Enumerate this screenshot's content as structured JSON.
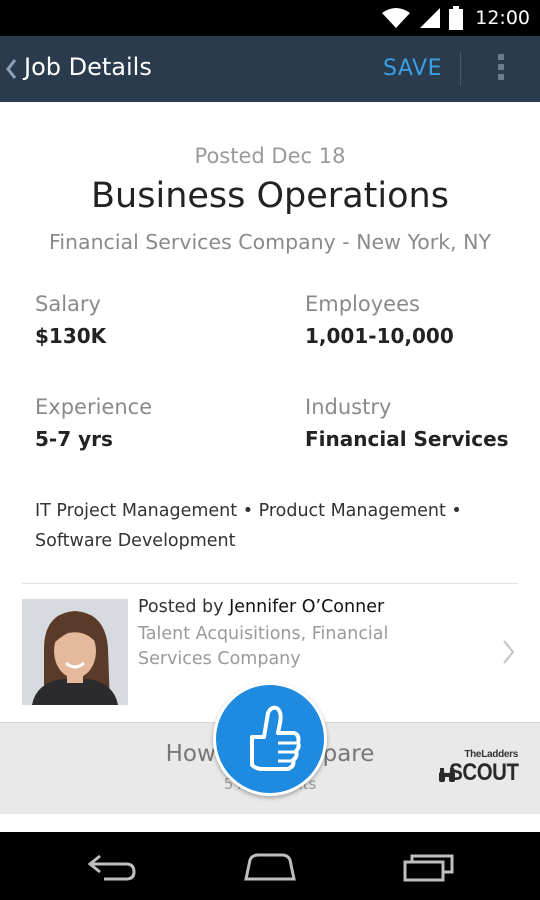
{
  "status_bar": {
    "time": "12:00",
    "icons": [
      "wifi-icon",
      "signal-icon",
      "battery-icon"
    ]
  },
  "action_bar": {
    "back_icon": "chevron-left-icon",
    "title": "Job Details",
    "save_label": "SAVE",
    "overflow_icon": "overflow-menu-icon"
  },
  "job": {
    "posted": "Posted Dec 18",
    "title": "Business Operations",
    "company_location": "Financial Services Company - New York, NY",
    "stats": {
      "salary_label": "Salary",
      "salary_value": "$130K",
      "employees_label": "Employees",
      "employees_value": "1,001-10,000",
      "experience_label": "Experience",
      "experience_value": "5-7 yrs",
      "industry_label": "Industry",
      "industry_value": "Financial Services"
    },
    "skills_line1": "IT Project Management • Product Management •",
    "skills_line2": "Software Development"
  },
  "poster": {
    "prefix": "Posted by ",
    "name": "Jennifer O’Conner",
    "role_line1": "Talent Acquisitions, Financial",
    "role_line2": "Services Company"
  },
  "compare": {
    "title": "How You Compare",
    "subtitle": "5 Applicants",
    "logo_small": "TheLadders",
    "logo_big": "SCOUT"
  },
  "nav_bar": {
    "icons": [
      "back-nav-icon",
      "home-nav-icon",
      "recents-nav-icon"
    ]
  },
  "colors": {
    "action_bar": "#2a3b4d",
    "accent": "#39a0e6",
    "thumb_button": "#1e8be0"
  }
}
